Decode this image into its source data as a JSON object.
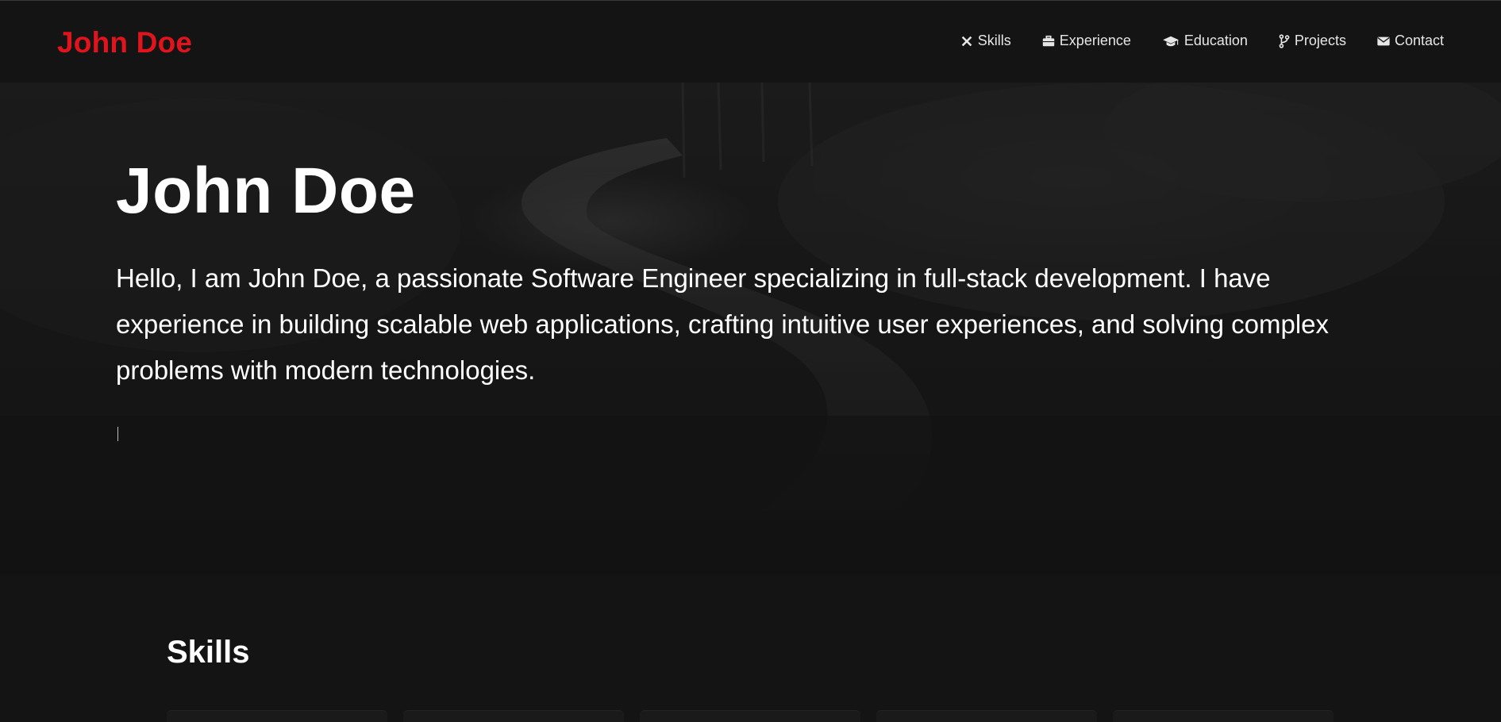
{
  "brand": "John Doe",
  "nav": {
    "items": [
      {
        "label": "Skills",
        "icon": "tools-icon"
      },
      {
        "label": "Experience",
        "icon": "briefcase-icon"
      },
      {
        "label": "Education",
        "icon": "graduation-cap-icon"
      },
      {
        "label": "Projects",
        "icon": "code-branch-icon"
      },
      {
        "label": "Contact",
        "icon": "envelope-icon"
      }
    ]
  },
  "hero": {
    "title": "John Doe",
    "intro": "Hello, I am John Doe, a passionate Software Engineer specializing in full-stack development. I have experience in building scalable web applications, crafting intuitive user experiences, and solving complex problems with modern technologies."
  },
  "skills": {
    "title": "Skills"
  },
  "colors": {
    "accent": "#e0141c",
    "background": "#141414",
    "text": "#ffffff"
  }
}
